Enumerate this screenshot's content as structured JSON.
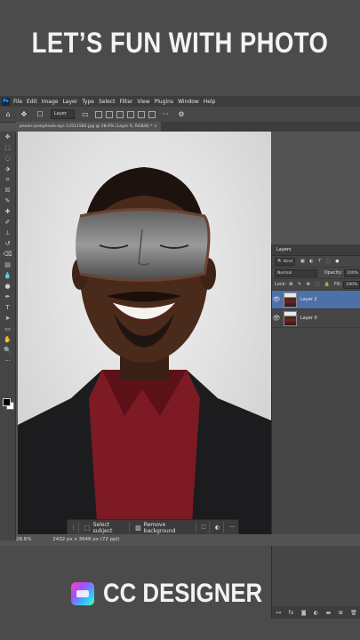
{
  "banner": {
    "title": "LET’S FUN WITH PHOTO"
  },
  "app": {
    "logo": "Ps",
    "menu": [
      "File",
      "Edit",
      "Image",
      "Layer",
      "Type",
      "Select",
      "Filter",
      "View",
      "Plugins",
      "Window",
      "Help"
    ],
    "options": {
      "auto_select_target": "Layer"
    },
    "document_tab": "pexels-josephsolo-ayc-12511582.jpg @ 28.6% (Layer 0, RGB/8) *",
    "status": {
      "zoom": "28.6%",
      "doc_size": "2432 px x 3648 px (72 ppi)"
    },
    "context_bar": {
      "select_subject": "Select subject",
      "remove_background": "Remove background",
      "more": "···"
    }
  },
  "layers_panel": {
    "tab": "Layers",
    "filter_kind": "Kind",
    "blend_mode": "Normal",
    "opacity_label": "Opacity:",
    "opacity_value": "100%",
    "lock_label": "Lock:",
    "fill_label": "Fill:",
    "fill_value": "100%",
    "layers": [
      {
        "name": "Layer 2",
        "selected": true
      },
      {
        "name": "Layer 0",
        "selected": false
      }
    ]
  },
  "brand": {
    "name": "CC DESIGNER"
  },
  "colors": {
    "background": "#4b4b4b",
    "panel": "#535353",
    "selection": "#4e70a9",
    "shirt": "#8a1d26"
  }
}
